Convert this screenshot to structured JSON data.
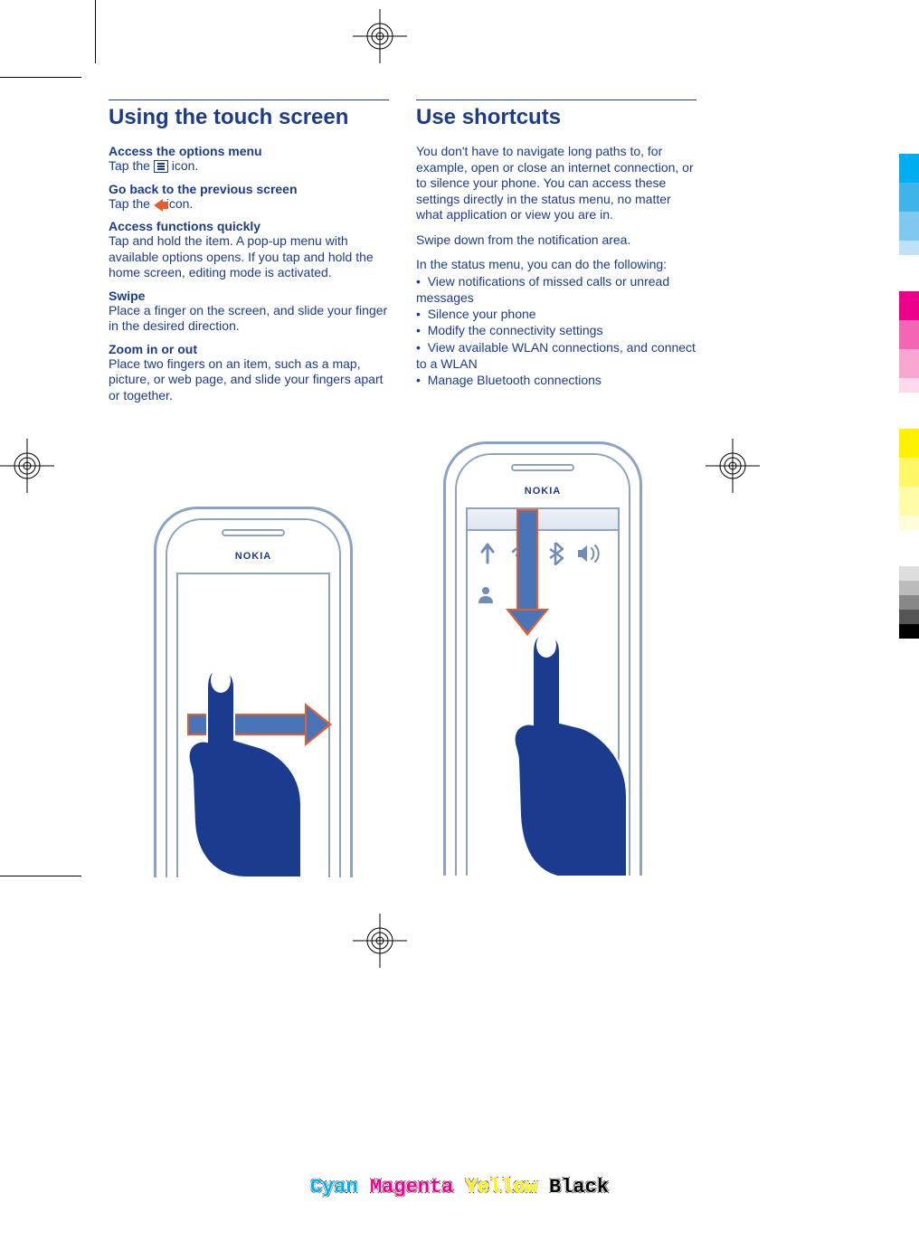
{
  "left": {
    "heading": "Using the touch screen",
    "sections": [
      {
        "title": "Access the options menu",
        "pre": "Tap the ",
        "icon": "menu",
        "post": " icon."
      },
      {
        "title": "Go back to the previous screen",
        "pre": "Tap the ",
        "icon": "back",
        "post": " icon."
      },
      {
        "title": "Access functions quickly",
        "body": "Tap and hold the item. A pop-up menu with available options opens. If you tap and hold the home screen, editing mode is activated."
      },
      {
        "title": "Swipe",
        "body": "Place a finger on the screen, and slide your finger in the desired direction."
      },
      {
        "title": "Zoom in or out",
        "body": "Place two fingers on an item, such as a map, picture, or web page, and slide your fingers apart or together."
      }
    ]
  },
  "right": {
    "heading": "Use shortcuts",
    "intro": "You don't have to navigate long paths to, for example, open or close an internet connection, or to silence your phone. You can access these settings directly in the status menu, no matter what application or view you are in.",
    "swipe_instruction": "Swipe down from the notification area.",
    "list_intro": "In the status menu, you can do the following:",
    "bullets": [
      "View notifications of missed calls or unread messages",
      "Silence your phone",
      "Modify the connectivity settings",
      "View available WLAN connections, and connect to a WLAN",
      "Manage Bluetooth connections"
    ]
  },
  "brand": "NOKIA",
  "colorbars": [
    "#00aeef",
    "#3fb4e8",
    "#7fc9ef",
    "#bfe1f6",
    "#ec008c",
    "#f266b3",
    "#f7a6d1",
    "#fcd9ec",
    "#fff200",
    "#fff766",
    "#fffba6",
    "#fffdd9",
    "#000000",
    "#555555",
    "#888888",
    "#bbbbbb",
    "#dddddd"
  ],
  "footer": {
    "cyan": "Cyan",
    "magenta": "Magenta",
    "yellow": "Yellow",
    "black": "Black"
  }
}
